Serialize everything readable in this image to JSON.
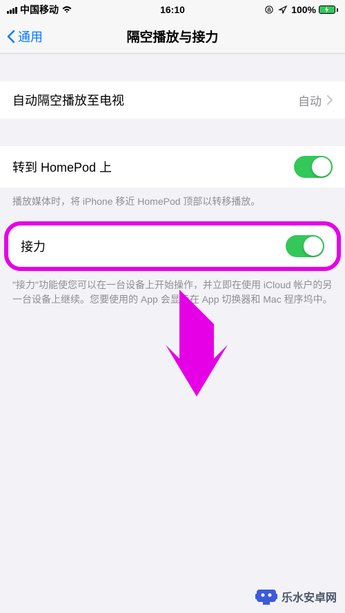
{
  "statusBar": {
    "carrier": "中国移动",
    "time": "16:10",
    "battery": "100%"
  },
  "nav": {
    "back": "通用",
    "title": "隔空播放与接力"
  },
  "cells": {
    "autoAirplay": {
      "title": "自动隔空播放至电视",
      "value": "自动"
    },
    "homepod": {
      "title": "转到 HomePod 上",
      "footer": "播放媒体时，将 iPhone 移近 HomePod 顶部以转移播放。"
    },
    "handoff": {
      "title": "接力",
      "footer": "\"接力\"功能使您可以在一台设备上开始操作，并立即在使用 iCloud 帐户的另一台设备上继续。您要使用的 App 会显示在 App 切换器和 Mac 程序坞中。"
    }
  },
  "watermark": {
    "text": "乐水安卓网"
  }
}
